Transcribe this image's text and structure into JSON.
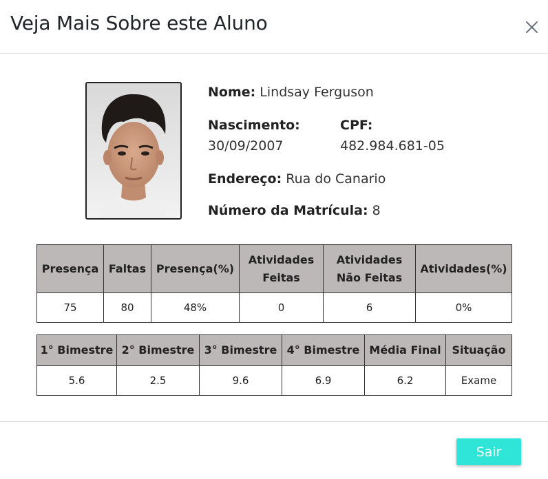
{
  "modal": {
    "title": "Veja Mais Sobre este Aluno",
    "close_icon": "close-icon"
  },
  "student": {
    "name_label": "Nome:",
    "name": "Lindsay Ferguson",
    "birth_label": "Nascimento:",
    "birth": "30/09/2007",
    "cpf_label": "CPF:",
    "cpf": "482.984.681-05",
    "address_label": "Endereço:",
    "address": "Rua do Canario",
    "enrollment_label": "Número da Matrícula:",
    "enrollment": "8"
  },
  "attendance_table": {
    "headers": [
      "Presença",
      "Faltas",
      "Presença(%)",
      "Atividades Feitas",
      "Atividades Não Feitas",
      "Atividades(%)"
    ],
    "row": [
      "75",
      "80",
      "48%",
      "0",
      "6",
      "0%"
    ]
  },
  "grades_table": {
    "headers": [
      "1° Bimestre",
      "2° Bimestre",
      "3° Bimestre",
      "4° Bimestre",
      "Média Final",
      "Situação"
    ],
    "row": [
      "5.6",
      "2.5",
      "9.6",
      "6.9",
      "6.2",
      "Exame"
    ]
  },
  "footer": {
    "exit_label": "Sair"
  },
  "colors": {
    "accent": "#2ee5d8",
    "table_header": "#bcb8b8"
  }
}
